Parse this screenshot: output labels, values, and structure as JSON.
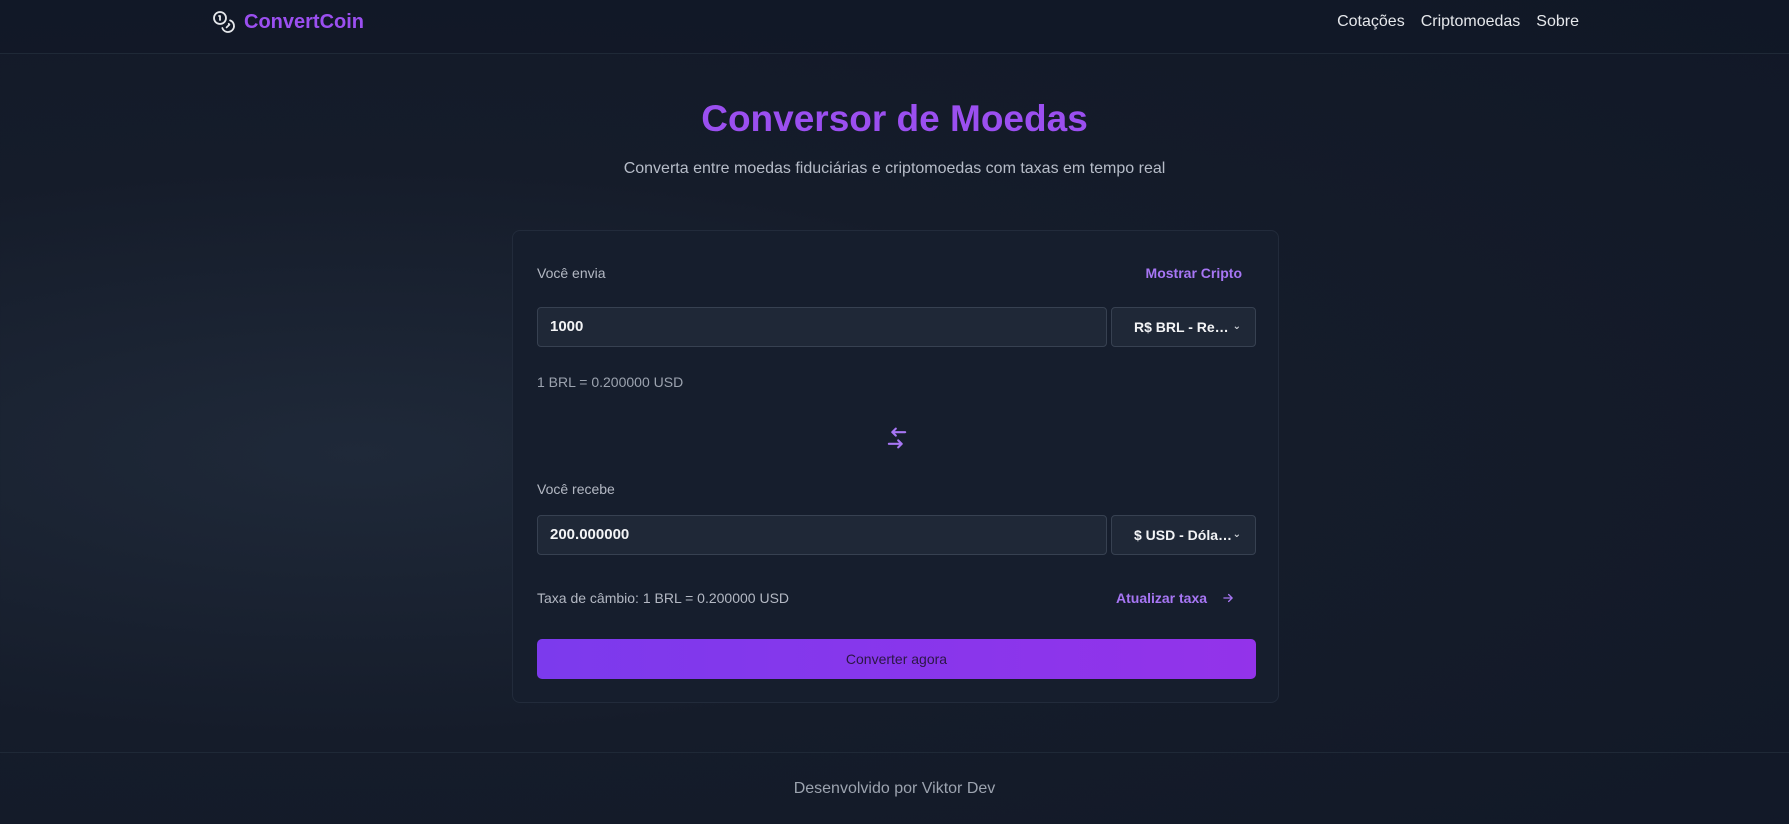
{
  "header": {
    "brand": "ConvertCoin",
    "nav": [
      "Cotações",
      "Criptomoedas",
      "Sobre"
    ]
  },
  "hero": {
    "title": "Conversor de Moedas",
    "subtitle": "Converta entre moedas fiduciárias e criptomoedas com taxas em tempo real"
  },
  "converter": {
    "send_label": "Você envia",
    "show_crypto": "Mostrar Cripto",
    "send_value": "1000",
    "send_currency": "R$ BRL - Real Brasileiro",
    "send_rate": "1 BRL = 0.200000 USD",
    "receive_label": "Você recebe",
    "receive_value": "200.000000",
    "receive_currency": "$ USD - Dólar Americano",
    "exchange_rate": "Taxa de câmbio: 1 BRL = 0.200000 USD",
    "update_rate": "Atualizar taxa",
    "convert_button": "Converter agora"
  },
  "footer": {
    "text": "Desenvolvido por Viktor Dev"
  },
  "colors": {
    "accent": "#9b4ff0",
    "button_start": "#7c3aed",
    "button_end": "#9333ea",
    "background": "#111827"
  },
  "icons": {
    "brand": "coins-icon",
    "swap": "swap-arrows-icon",
    "update": "arrow-right-icon",
    "dropdown": "chevron-down-icon"
  }
}
